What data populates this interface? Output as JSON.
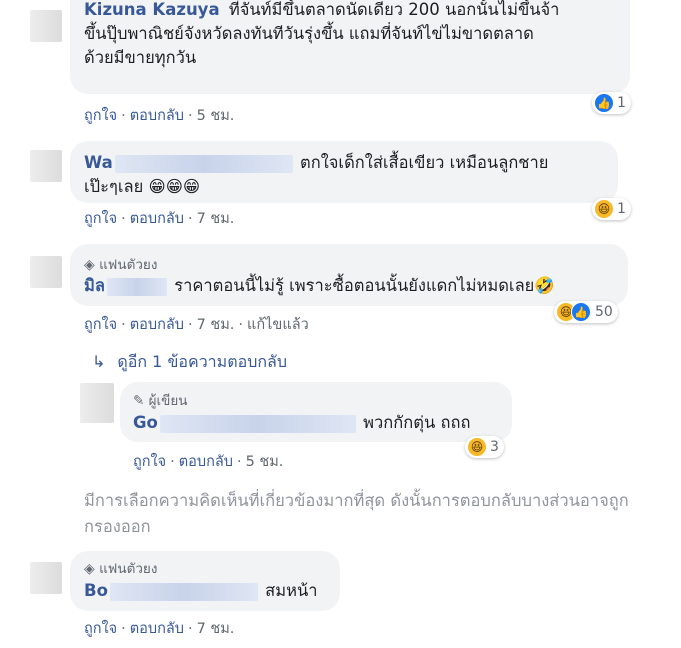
{
  "comments": [
    {
      "name": "Kizuna Kazuya",
      "text_lines": [
        "ที่จันท์มีขึ้นตลาดนัดเดียว 200 นอกนั้นไม่ขึ้นจ้า",
        "ขึ้นปุ๊บพาณิชย์จังหวัดลงทันทีวันรุ่งขึ้น แถมที่จันท์ไข่ไม่ขาดตลาด",
        "ด้วยมีขายทุกวัน"
      ],
      "like_label": "ถูกใจ",
      "reply_label": "ตอบกลับ",
      "time": "5 ชม.",
      "reaction_count": "1"
    },
    {
      "name": "Wa",
      "text_lines": [
        "ตกใจเด็กใส่เสื้อเขียว เหมือนลูกชาย",
        "เป๊ะๆเลย 😁😁😁"
      ],
      "like_label": "ถูกใจ",
      "reply_label": "ตอบกลับ",
      "time": "7 ชม.",
      "reaction_count": "1"
    },
    {
      "badge": "แฟนตัวยง",
      "name": "มิล",
      "text": "ราคาตอนนี้ไม่รู้ เพราะซื้อตอนนั้นยังแดกไม่หมดเลย🤣",
      "like_label": "ถูกใจ",
      "reply_label": "ตอบกลับ",
      "time": "7 ชม.",
      "edited": "แก้ไขแล้ว",
      "reaction_count": "50"
    }
  ],
  "more_replies": "ดูอีก 1 ข้อความตอบกลับ",
  "reply": {
    "badge": "ผู้เขียน",
    "name": "Go",
    "text": "พวกกักตุ่น ถถถ",
    "like_label": "ถูกใจ",
    "reply_label": "ตอบกลับ",
    "time": "5 ชม.",
    "reaction_count": "3"
  },
  "filter_note": "มีการเลือกความคิดเห็นที่เกี่ยวข้องมากที่สุด ดังนั้นการตอบกลับบางส่วนอาจถูกกรองออก",
  "last_comment": {
    "badge": "แฟนตัวยง",
    "name": "Bo",
    "text": "สมหน้า",
    "like_label": "ถูกใจ",
    "reply_label": "ตอบกลับ",
    "time": "7 ชม."
  },
  "separator": "·",
  "colors": {
    "name": "#385898",
    "bubble": "#f2f3f5",
    "meta": "#606770",
    "like": "#1877f2",
    "haha": "#f7b928"
  }
}
